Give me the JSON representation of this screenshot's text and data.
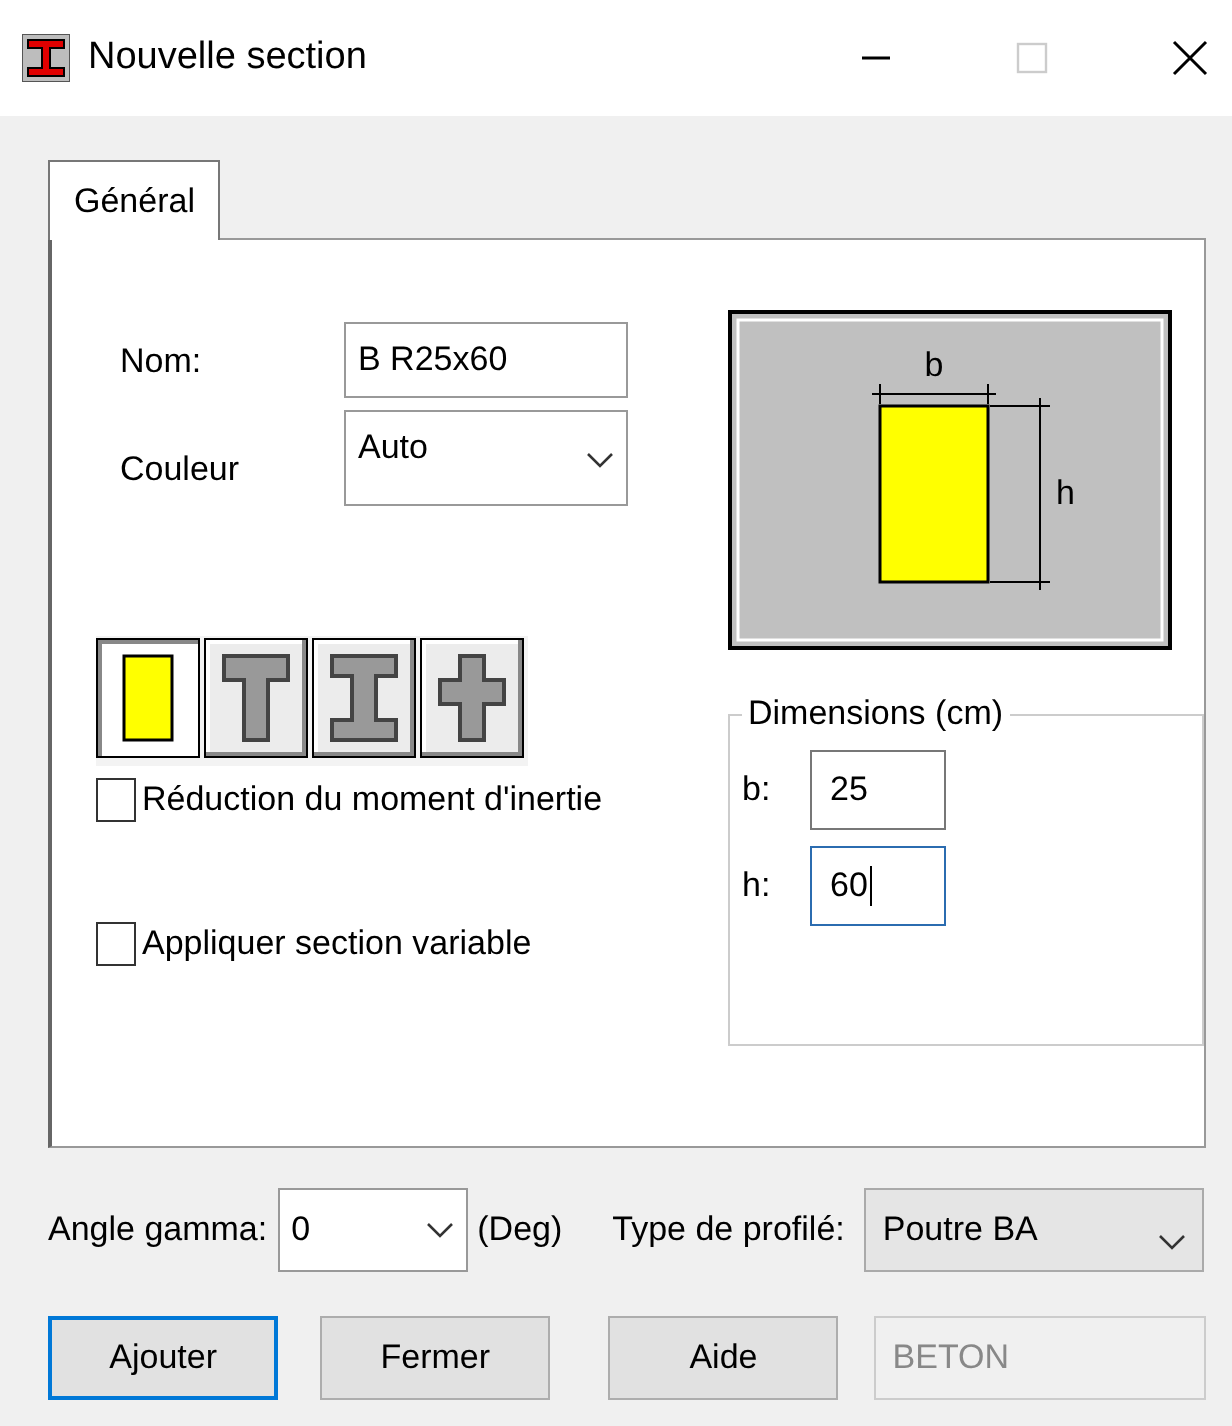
{
  "window": {
    "title": "Nouvelle section"
  },
  "tabs": [
    {
      "label": "Général",
      "selected": true
    }
  ],
  "form": {
    "name_label": "Nom:",
    "name_value": "B R25x60",
    "color_label": "Couleur",
    "color_value": "Auto"
  },
  "section_types": [
    {
      "kind": "rect",
      "selected": true
    },
    {
      "kind": "tee",
      "selected": false
    },
    {
      "kind": "ibeam",
      "selected": false
    },
    {
      "kind": "cross",
      "selected": false
    }
  ],
  "preview": {
    "b_label": "b",
    "h_label": "h"
  },
  "options": [
    {
      "label": "Réduction du moment d'inertie",
      "checked": false
    },
    {
      "label": "Appliquer section variable",
      "checked": false
    }
  ],
  "dimensions": {
    "title": "Dimensions (cm)",
    "fields": [
      {
        "label": "b:",
        "value": "25",
        "focused": false
      },
      {
        "label": "h:",
        "value": "60",
        "focused": true
      }
    ]
  },
  "angle": {
    "label": "Angle gamma:",
    "value": "0",
    "unit": "(Deg)"
  },
  "profile": {
    "label": "Type de profilé:",
    "value": "Poutre BA"
  },
  "buttons": [
    {
      "label": "Ajouter",
      "default": true
    },
    {
      "label": "Fermer",
      "default": false
    },
    {
      "label": "Aide",
      "default": false
    }
  ],
  "material": {
    "value": "BETON",
    "disabled": true
  }
}
